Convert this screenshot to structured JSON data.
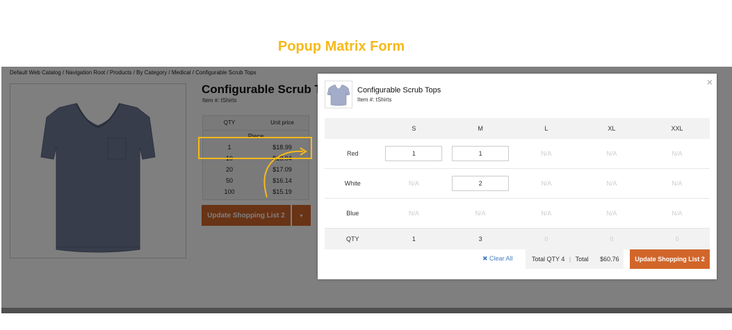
{
  "heading": "Popup Matrix Form",
  "breadcrumb": "Default Web Catalog / Navigation Root / Products / By Category / Medical / Configurable Scrub Tops",
  "product": {
    "title": "Configurable Scrub Tops",
    "item": "Item #: tShirts"
  },
  "price_table": {
    "headers": [
      "QTY",
      "Unit price"
    ],
    "unit": "Piece",
    "rows": [
      {
        "qty": "1",
        "price": "$18.99"
      },
      {
        "qty": "10",
        "price": "$18.04"
      },
      {
        "qty": "20",
        "price": "$17.09"
      },
      {
        "qty": "50",
        "price": "$16.14"
      },
      {
        "qty": "100",
        "price": "$15.19"
      }
    ]
  },
  "update_button": {
    "label": "Update Shopping List 2",
    "caret": "▾"
  },
  "modal": {
    "close": "×",
    "title": "Configurable Scrub Tops",
    "item": "Item #: tShirts",
    "sizes": [
      "S",
      "M",
      "L",
      "XL",
      "XXL"
    ],
    "rows": [
      {
        "color": "Red",
        "cells": [
          "1",
          "1",
          "N/A",
          "N/A",
          "N/A"
        ]
      },
      {
        "color": "White",
        "cells": [
          "N/A",
          "2",
          "N/A",
          "N/A",
          "N/A"
        ]
      },
      {
        "color": "Blue",
        "cells": [
          "N/A",
          "N/A",
          "N/A",
          "N/A",
          "N/A"
        ]
      }
    ],
    "qty_label": "QTY",
    "qty_totals": [
      "1",
      "3",
      "0",
      "0",
      "0"
    ],
    "clear_all": "✖ Clear All",
    "total_qty": "Total QTY 4",
    "separator": "|",
    "total_label": "Total",
    "total_value": "$60.76",
    "update_label": "Update Shopping List 2"
  },
  "colors": {
    "accent": "#d2662a",
    "highlight": "#f5b91a",
    "link": "#4a7fc1"
  },
  "icons": {
    "shirt": "scrub-shirt-image",
    "close": "close-icon",
    "clear": "clear-icon",
    "arrow": "curved-arrow"
  }
}
